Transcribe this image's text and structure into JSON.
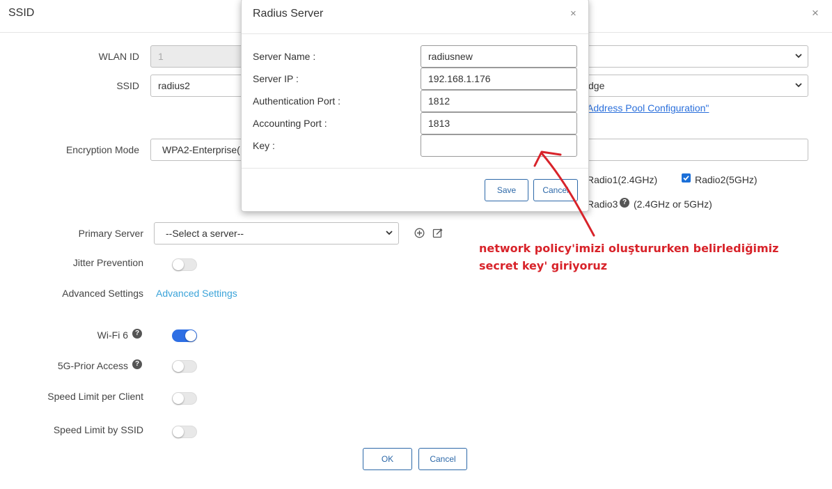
{
  "dialog": {
    "title": "SSID",
    "close": "×"
  },
  "form": {
    "wlan_id_label": "WLAN ID",
    "wlan_id_value": "1",
    "ssid_label": "SSID",
    "ssid_value": "radius2",
    "right_select_1_value": "",
    "right_select_2_value": "dge",
    "address_pool_link": "Address Pool Configuration\"",
    "encryption_label": "Encryption Mode",
    "encryption_value": "WPA2-Enterprise(",
    "radio1_label": "Radio1(2.4GHz)",
    "radio2_label": "Radio2(5GHz)",
    "radio2_checked": true,
    "radio3_label": "Radio3",
    "radio3_note": "(2.4GHz or 5GHz)",
    "primary_server_label": "Primary Server",
    "primary_server_value": "--Select a server--",
    "jitter_label": "Jitter Prevention",
    "jitter_on": false,
    "advanced_label": "Advanced Settings",
    "advanced_link": "Advanced Settings",
    "wifi6_label": "Wi-Fi 6",
    "wifi6_on": true,
    "prior5g_label": "5G-Prior Access",
    "prior5g_on": false,
    "speed_client_label": "Speed Limit per Client",
    "speed_client_on": false,
    "speed_ssid_label": "Speed Limit by SSID",
    "speed_ssid_on": false,
    "ok_button": "OK",
    "cancel_button": "Cancel"
  },
  "radius_modal": {
    "title": "Radius Server",
    "close": "×",
    "server_name_label": "Server Name :",
    "server_name_value": "radiusnew",
    "server_ip_label": "Server IP :",
    "server_ip_value": "192.168.1.176",
    "auth_port_label": "Authentication Port :",
    "auth_port_value": "1812",
    "acct_port_label": "Accounting Port :",
    "acct_port_value": "1813",
    "key_label": "Key :",
    "key_value": "",
    "save_button": "Save",
    "cancel_button": "Cancel"
  },
  "annotation": {
    "line1": "network policy'imizi oluştururken belirlediğimiz",
    "line2": "secret key' giriyoruz",
    "color": "#d8232a"
  },
  "colors": {
    "accent_blue": "#2e6fe4",
    "button_border": "#2c68a8",
    "link_blue": "#2a6fdb"
  }
}
